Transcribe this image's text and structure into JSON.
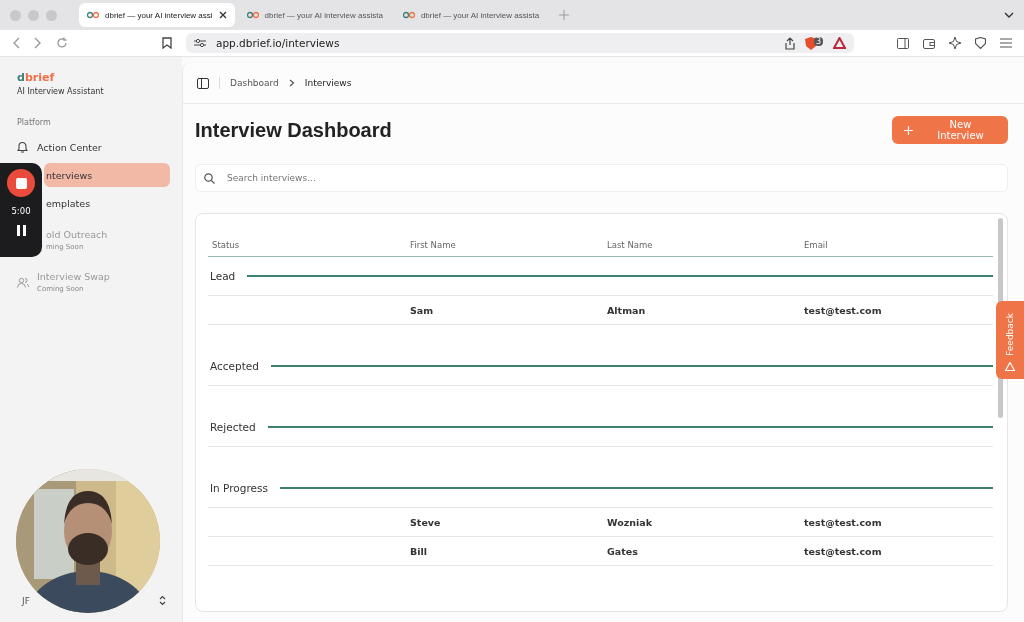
{
  "browser": {
    "tabs": [
      {
        "title": "dbrief — your AI interview assi",
        "selected": true
      },
      {
        "title": "dbrief — your AI interview assista",
        "selected": false
      },
      {
        "title": "dbrief — your AI interview assista",
        "selected": false
      }
    ],
    "url": "app.dbrief.io/interviews",
    "shield_count": "3"
  },
  "sidebar": {
    "logo_prefix": "d",
    "logo_suffix": "brief",
    "subtitle": "AI Interview Assistant",
    "section": "Platform",
    "items": [
      {
        "label": "Action Center",
        "selected": false,
        "disabled": false
      },
      {
        "label": "nterviews",
        "selected": true,
        "disabled": false
      },
      {
        "label": "emplates",
        "selected": false,
        "disabled": false
      },
      {
        "label": "old Outreach",
        "note": "ming Soon",
        "selected": false,
        "disabled": true
      },
      {
        "label": "Interview Swap",
        "note": "Coming Soon",
        "selected": false,
        "disabled": true
      }
    ],
    "user_initials": "JF"
  },
  "recorder": {
    "time": "5:00"
  },
  "breadcrumb": [
    "Dashboard",
    "Interviews"
  ],
  "title": "Interview Dashboard",
  "new_button": "New Interview",
  "search": {
    "placeholder": "Search interviews..."
  },
  "table": {
    "columns": [
      "Status",
      "First Name",
      "Last Name",
      "Email"
    ],
    "groups": [
      {
        "name": "Lead",
        "rows": [
          {
            "first": "Sam",
            "last": "Altman",
            "email": "test@test.com"
          }
        ]
      },
      {
        "name": "Accepted"
      },
      {
        "name": "Rejected"
      },
      {
        "name": "In Progress",
        "rows": [
          {
            "first": "Steve",
            "last": "Wozniak",
            "email": "test@test.com"
          },
          {
            "first": "Bill",
            "last": "Gates",
            "email": "test@test.com"
          }
        ]
      }
    ]
  },
  "feedback": "Feedback"
}
